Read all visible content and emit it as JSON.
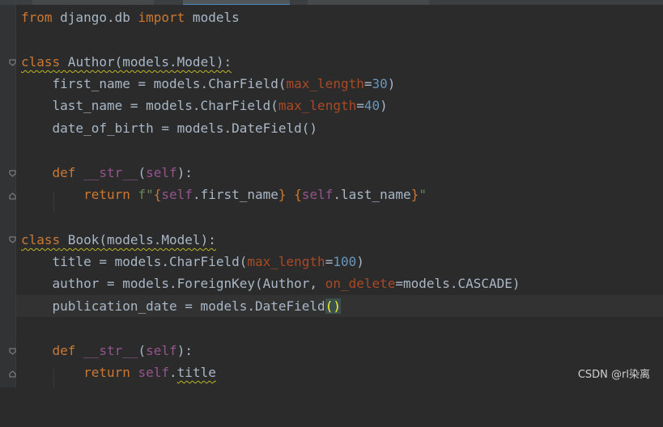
{
  "editor": {
    "line1": {
      "kw_from": "from",
      "module": " django.db ",
      "kw_import": "import",
      "name": " models"
    },
    "line3": {
      "kw_class": "class",
      "sig": " Author(models.Model):"
    },
    "line4": {
      "a": "    first_name = models.CharField(",
      "p": "max_length",
      "eq": "=",
      "n": "30",
      "close": ")"
    },
    "line5": {
      "a": "    last_name = models.CharField(",
      "p": "max_length",
      "eq": "=",
      "n": "40",
      "close": ")"
    },
    "line6": {
      "a": "    date_of_birth = models.DateField()"
    },
    "line8": {
      "indent": "    ",
      "kw_def": "def",
      "sp": " ",
      "fn": "__str__",
      "open": "(",
      "self": "self",
      "close": "):"
    },
    "line9": {
      "indent": "        ",
      "kw_return": "return",
      "f": " f\"",
      "b1o": "{",
      "s1": "self",
      "a1": ".first_name",
      "b1c": "}",
      "sp": " ",
      "b2o": "{",
      "s2": "self",
      "a2": ".last_name",
      "b2c": "}",
      "q": "\""
    },
    "line11": {
      "kw_class": "class",
      "sig": " Book(models.Model):"
    },
    "line12": {
      "a": "    title = models.CharField(",
      "p": "max_length",
      "eq": "=",
      "n": "100",
      "close": ")"
    },
    "line13": {
      "a": "    author = models.ForeignKey(Author, ",
      "p": "on_delete",
      "rest": "=models.CASCADE)"
    },
    "line14": {
      "a": "    publication_date = models.DateField",
      "paren": "()"
    },
    "line16": {
      "indent": "    ",
      "kw_def": "def",
      "sp": " ",
      "fn": "__str__",
      "open": "(",
      "self": "self",
      "close": "):"
    },
    "line17": {
      "indent": "        ",
      "kw_return": "return",
      "sp": " ",
      "self": "self",
      "dot": ".",
      "attr": "title"
    }
  },
  "watermark": "CSDN @rl染离",
  "icons": [
    "fold-arrow-icon",
    "fold-end-icon"
  ]
}
